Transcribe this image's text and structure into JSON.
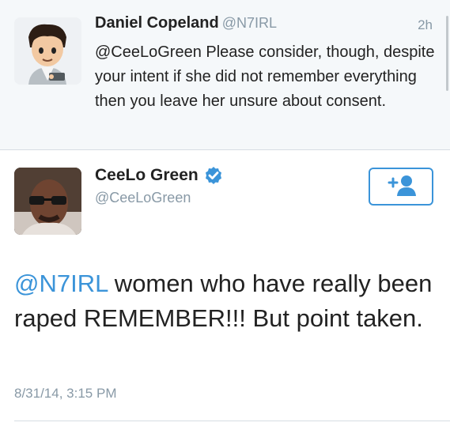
{
  "reply_tweet": {
    "name": "Daniel Copeland",
    "handle": "@N7IRL",
    "time": "2h",
    "text": "@CeeLoGreen Please consider, though, despite your intent if she did not remember everything then you leave her unsure about consent."
  },
  "main_tweet": {
    "name": "CeeLo Green",
    "handle": "@CeeLoGreen",
    "mention": "@N7IRL",
    "text": " women who  have really been raped REMEMBER!!! But point taken.",
    "date": "8/31/14, 3:15 PM"
  },
  "icons": {
    "verified": "verified-badge-icon",
    "follow": "add-user-icon"
  },
  "colors": {
    "accent": "#3b94d9",
    "secondary_text": "#8899a6",
    "reply_background": "#f5f8fa"
  }
}
